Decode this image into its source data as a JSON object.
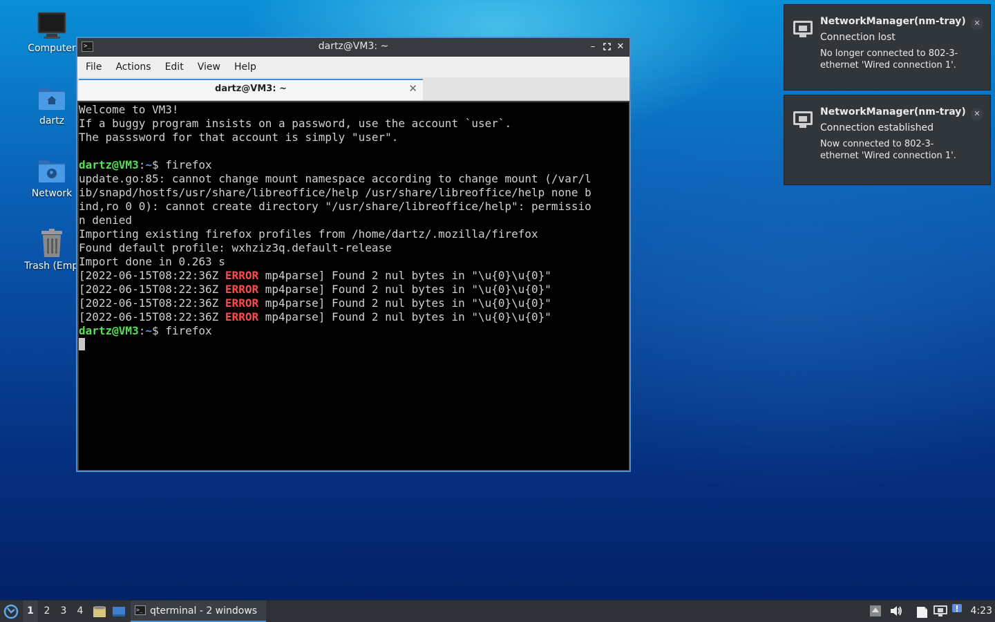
{
  "desktop": {
    "icons": [
      {
        "label": "Computer"
      },
      {
        "label": "dartz"
      },
      {
        "label": "Network"
      },
      {
        "label": "Trash (Empty)"
      }
    ]
  },
  "window": {
    "title": "dartz@VM3: ~",
    "menu": [
      "File",
      "Actions",
      "Edit",
      "View",
      "Help"
    ],
    "tab_label": "dartz@VM3: ~",
    "prompt_user": "dartz@VM3",
    "prompt_sep": ":",
    "prompt_path": "~",
    "prompt_dollar": "$ ",
    "lines": {
      "welcome1": "Welcome to VM3!",
      "welcome2": "If a buggy program insists on a password, use the account `user`.",
      "welcome3": "The passsword for that account is simply \"user\".",
      "cmd1": "firefox",
      "out1": "update.go:85: cannot change mount namespace according to change mount (/var/l",
      "out2": "ib/snapd/hostfs/usr/share/libreoffice/help /usr/share/libreoffice/help none b",
      "out3": "ind,ro 0 0): cannot create directory \"/usr/share/libreoffice/help\": permissio",
      "out4": "n denied",
      "out5": "Importing existing firefox profiles from /home/dartz/.mozilla/firefox",
      "out6": "Found default profile: wxhziz3q.default-release",
      "out7": "Import done in 0.263 s",
      "err_prefix": "[2022-06-15T08:22:36Z ",
      "err_word": "ERROR",
      "err_suffix": " mp4parse] Found 2 nul bytes in \"\\u{0}\\u{0}\"",
      "cmd2": "firefox"
    }
  },
  "notifications": [
    {
      "app": "NetworkManager(nm-tray)",
      "summary": "Connection lost",
      "body": "No longer connected to 802-3-ethernet 'Wired connection 1'."
    },
    {
      "app": "NetworkManager(nm-tray)",
      "summary": "Connection established",
      "body": "Now connected to 802-3-ethernet 'Wired connection 1'."
    }
  ],
  "taskbar": {
    "workspaces": [
      "1",
      "2",
      "3",
      "4"
    ],
    "active_workspace": "1",
    "task_label": "qterminal - 2 windows",
    "clock": "4:23"
  },
  "colors": {
    "accent": "#3d8ee0",
    "prompt_user": "#55e055",
    "prompt_path": "#5d8fff",
    "error": "#ff4a4a"
  }
}
